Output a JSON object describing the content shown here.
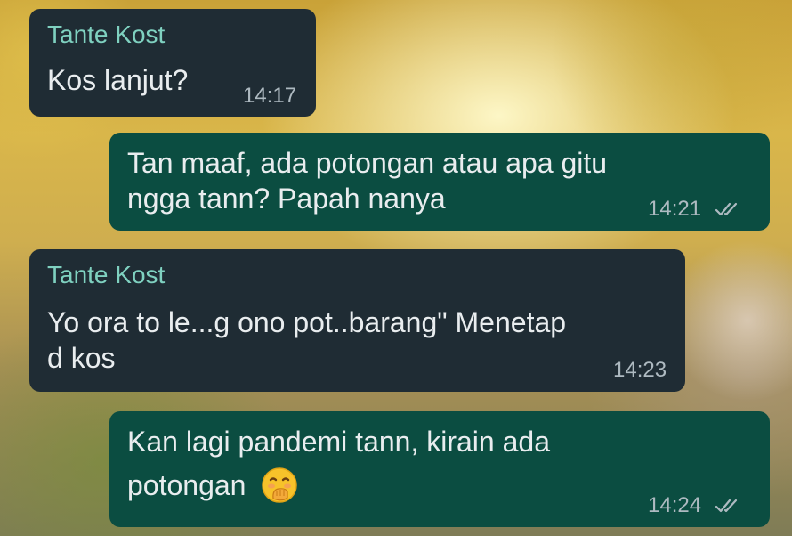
{
  "chat": {
    "messages": [
      {
        "direction": "incoming",
        "sender": "Tante Kost",
        "text": "Kos lanjut?",
        "time": "14:17"
      },
      {
        "direction": "outgoing",
        "text_line1": "Tan maaf, ada potongan atau apa gitu",
        "text_line2": "ngga tann? Papah nanya",
        "time": "14:21",
        "status_icon": "double-check-icon"
      },
      {
        "direction": "incoming",
        "sender": "Tante Kost",
        "text_line1": "Yo ora to le...g ono pot..barang\" Menetap",
        "text_line2": "d kos",
        "time": "14:23"
      },
      {
        "direction": "outgoing",
        "text_line1": "Kan lagi pandemi tann, kirain ada",
        "text_line2": "potongan",
        "emoji": "face-with-hand-over-mouth-emoji",
        "time": "14:24",
        "status_icon": "double-check-icon"
      }
    ]
  },
  "colors": {
    "incoming_bubble": "#1f2c34",
    "outgoing_bubble": "#0b4d41",
    "sender_name": "#7fd1c0",
    "timestamp": "#aebac1"
  }
}
